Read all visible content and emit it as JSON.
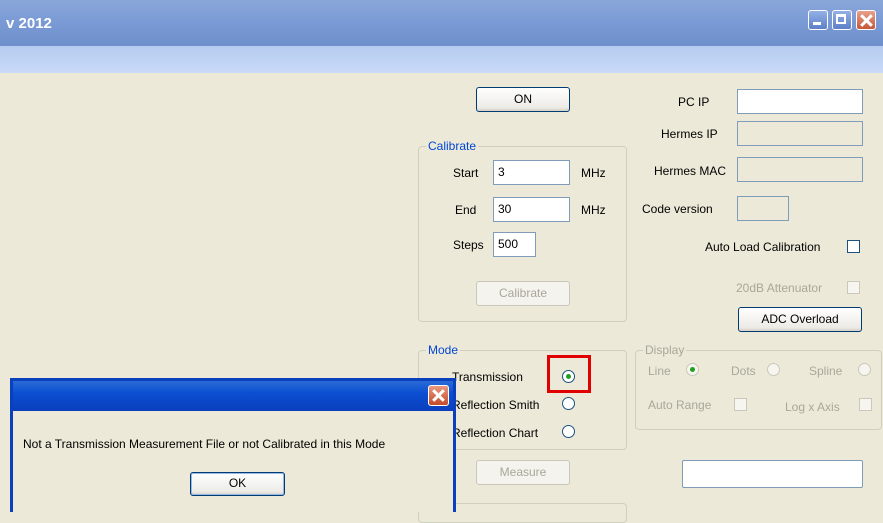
{
  "window": {
    "title": "v 2012"
  },
  "buttons": {
    "on": "ON",
    "calibrate": "Calibrate",
    "adc_overload": "ADC Overload",
    "measure": "Measure"
  },
  "network": {
    "pc_ip_label": "PC IP",
    "pc_ip_value": "",
    "hermes_ip_label": "Hermes IP",
    "hermes_mac_label": "Hermes MAC",
    "code_version_label": "Code version",
    "auto_load_label": "Auto Load Calibration",
    "attenuator_label": "20dB Attenuator"
  },
  "calibrate": {
    "caption": "Calibrate",
    "start_label": "Start",
    "start_value": "3",
    "start_unit": "MHz",
    "end_label": "End",
    "end_value": "30",
    "end_unit": "MHz",
    "steps_label": "Steps",
    "steps_value": "500"
  },
  "mode": {
    "caption": "Mode",
    "transmission": "Transmission",
    "reflection_smith": "Reflection Smith",
    "reflection_chart": "Reflection Chart",
    "selected": "Transmission"
  },
  "display": {
    "caption": "Display",
    "line": "Line",
    "dots": "Dots",
    "spline": "Spline",
    "auto_range": "Auto Range",
    "log_x_axis": "Log x Axis"
  },
  "dialog": {
    "message": "Not a Transmission Measurement File or not Calibrated in this Mode",
    "ok": "OK"
  },
  "colors": {
    "titlebar": "#7b9bd6",
    "highlight": "#e00000",
    "dialog_title": "#0a3fbd",
    "groupbox_caption": "#0046d5"
  }
}
